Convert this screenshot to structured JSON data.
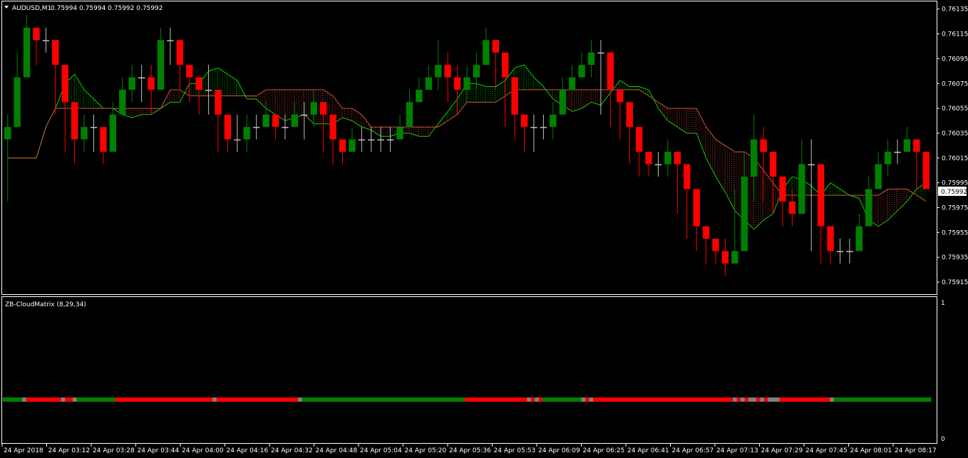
{
  "header": {
    "symbol": "AUDUSD,M1",
    "quotes": "0.75994 0.75994 0.75992 0.75992",
    "dropdown_icon": "triangle-down-icon"
  },
  "subwindow": {
    "title": "ZB-CloudMatrix (8,29,34)",
    "axis_top": "1",
    "axis_bottom": "0"
  },
  "colors": {
    "background": "#000000",
    "frame": "#ffffff",
    "bull": "#008000",
    "bear": "#ff0000",
    "neutral": "#c0c0c0",
    "matrix_gray": "#808080",
    "cloud_up": "#00ff00",
    "cloud_down": "#ff6347"
  },
  "chart_data": [
    {
      "type": "candlestick",
      "title": "AUDUSD,M1",
      "y_ticks": [
        "0.76135",
        "0.76115",
        "0.76095",
        "0.76075",
        "0.76055",
        "0.76035",
        "0.76015",
        "0.75995",
        "0.75975",
        "0.75955",
        "0.75935",
        "0.75915"
      ],
      "ylim": [
        0.75907,
        0.7614
      ],
      "current_price_label": "0.75992",
      "x_ticks": [
        "24 Apr 2018",
        "24 Apr 03:12",
        "24 Apr 03:28",
        "24 Apr 03:44",
        "24 Apr 04:00",
        "24 Apr 04:16",
        "24 Apr 04:32",
        "24 Apr 04:48",
        "24 Apr 05:04",
        "24 Apr 05:20",
        "24 Apr 05:36",
        "24 Apr 05:53",
        "24 Apr 06:09",
        "24 Apr 06:25",
        "24 Apr 06:41",
        "24 Apr 06:57",
        "24 Apr 07:13",
        "24 Apr 07:29",
        "24 Apr 07:45",
        "24 Apr 08:01",
        "24 Apr 08:17"
      ],
      "close": [
        0.7604,
        0.7608,
        0.7612,
        0.7611,
        0.7611,
        0.7609,
        0.7606,
        0.7603,
        0.7604,
        0.7604,
        0.7602,
        0.7605,
        0.7607,
        0.7608,
        0.7608,
        0.7607,
        0.7611,
        0.7611,
        0.7609,
        0.7608,
        0.7607,
        0.7607,
        0.7605,
        0.7603,
        0.7603,
        0.7604,
        0.7604,
        0.7605,
        0.7604,
        0.7604,
        0.7605,
        0.7605,
        0.7606,
        0.7605,
        0.7603,
        0.7602,
        0.7603,
        0.7603,
        0.7603,
        0.7603,
        0.7603,
        0.7604,
        0.7606,
        0.7607,
        0.7608,
        0.7609,
        0.7608,
        0.7607,
        0.7608,
        0.7609,
        0.7611,
        0.761,
        0.7608,
        0.7605,
        0.7604,
        0.7604,
        0.7604,
        0.7605,
        0.7607,
        0.7608,
        0.7609,
        0.761,
        0.761,
        0.7607,
        0.7606,
        0.7604,
        0.7602,
        0.7601,
        0.7601,
        0.7602,
        0.7601,
        0.7599,
        0.7596,
        0.7595,
        0.7594,
        0.7593,
        0.7594,
        0.76,
        0.7603,
        0.7602,
        0.76,
        0.7598,
        0.7597,
        0.7601,
        0.7601,
        0.7596,
        0.7594,
        0.7594,
        0.7594,
        0.7596,
        0.7599,
        0.7601,
        0.7602,
        0.7602,
        0.7603,
        0.7602,
        0.7599
      ],
      "high": [
        0.7605,
        0.761,
        0.7613,
        0.7612,
        0.7612,
        0.761,
        0.7607,
        0.7604,
        0.7605,
        0.7605,
        0.7604,
        0.7606,
        0.7608,
        0.7609,
        0.7609,
        0.7609,
        0.7612,
        0.7612,
        0.7611,
        0.7609,
        0.7608,
        0.7609,
        0.7606,
        0.7604,
        0.7605,
        0.7605,
        0.7605,
        0.7606,
        0.7605,
        0.7605,
        0.7606,
        0.7606,
        0.7607,
        0.7606,
        0.7604,
        0.7603,
        0.7604,
        0.7604,
        0.7604,
        0.7604,
        0.7604,
        0.7605,
        0.7607,
        0.7608,
        0.7609,
        0.7611,
        0.761,
        0.7609,
        0.7609,
        0.761,
        0.7612,
        0.7611,
        0.7609,
        0.7607,
        0.7605,
        0.7605,
        0.7605,
        0.7606,
        0.7608,
        0.7609,
        0.761,
        0.7611,
        0.7611,
        0.7609,
        0.7607,
        0.7605,
        0.7603,
        0.7602,
        0.7602,
        0.7603,
        0.7602,
        0.76,
        0.7597,
        0.7596,
        0.7595,
        0.7595,
        0.7599,
        0.7602,
        0.7605,
        0.7604,
        0.7601,
        0.7599,
        0.7599,
        0.7603,
        0.7603,
        0.7597,
        0.7595,
        0.7595,
        0.7595,
        0.7597,
        0.76,
        0.7602,
        0.7603,
        0.7603,
        0.7604,
        0.7603,
        0.76
      ],
      "low": [
        0.7598,
        0.7606,
        0.761,
        0.7609,
        0.761,
        0.7605,
        0.7602,
        0.7601,
        0.7602,
        0.7602,
        0.7601,
        0.7603,
        0.7605,
        0.7606,
        0.7606,
        0.7605,
        0.7609,
        0.7609,
        0.7607,
        0.7606,
        0.7605,
        0.7605,
        0.7602,
        0.7602,
        0.7602,
        0.7602,
        0.7603,
        0.7604,
        0.7603,
        0.7603,
        0.7604,
        0.7603,
        0.7604,
        0.7602,
        0.7601,
        0.7601,
        0.7602,
        0.7602,
        0.7602,
        0.7602,
        0.7602,
        0.7603,
        0.7605,
        0.7606,
        0.7607,
        0.7607,
        0.7606,
        0.7605,
        0.7606,
        0.7607,
        0.7609,
        0.7607,
        0.7604,
        0.7603,
        0.7602,
        0.7602,
        0.7603,
        0.7603,
        0.7605,
        0.7607,
        0.7608,
        0.7608,
        0.7605,
        0.7604,
        0.7603,
        0.7601,
        0.76,
        0.76,
        0.76,
        0.76,
        0.7597,
        0.7595,
        0.7594,
        0.7593,
        0.7593,
        0.7592,
        0.7594,
        0.7599,
        0.7598,
        0.7598,
        0.7597,
        0.7596,
        0.7596,
        0.7597,
        0.7594,
        0.7593,
        0.7593,
        0.7593,
        0.7593,
        0.7594,
        0.7597,
        0.7599,
        0.76,
        0.7601,
        0.7602,
        0.7599,
        0.7599
      ]
    },
    {
      "type": "heatmap",
      "title": "ZB-CloudMatrix (8,29,34)",
      "ylim": [
        0,
        1
      ],
      "states": [
        "green",
        "green",
        "green",
        "green",
        "green",
        "gray",
        "red",
        "red",
        "red",
        "red",
        "red",
        "red",
        "red",
        "red",
        "red",
        "gray",
        "red",
        "red",
        "gray",
        "green",
        "green",
        "green",
        "green",
        "green",
        "green",
        "green",
        "green",
        "green",
        "green",
        "red",
        "red",
        "red",
        "red",
        "red",
        "red",
        "red",
        "red",
        "red",
        "red",
        "red",
        "red",
        "red",
        "red",
        "red",
        "red",
        "red",
        "red",
        "red",
        "red",
        "red",
        "red",
        "red",
        "red",
        "red",
        "gray",
        "red",
        "red",
        "red",
        "red",
        "red",
        "red",
        "red",
        "red",
        "red",
        "red",
        "red",
        "red",
        "red",
        "red",
        "red",
        "red",
        "red",
        "red",
        "red",
        "red",
        "red",
        "gray",
        "green",
        "green",
        "green",
        "green",
        "green",
        "green",
        "green",
        "green",
        "green",
        "green",
        "green",
        "green",
        "green",
        "green",
        "green",
        "green",
        "green",
        "green",
        "green",
        "green",
        "green",
        "green",
        "green",
        "green",
        "green",
        "green",
        "green",
        "green",
        "green",
        "green",
        "green",
        "green",
        "green",
        "green",
        "green",
        "green",
        "green",
        "green",
        "green",
        "green",
        "green",
        "green",
        "red",
        "red",
        "red",
        "red",
        "red",
        "red",
        "red",
        "red",
        "red",
        "red",
        "red",
        "red",
        "red",
        "red",
        "red",
        "red",
        "gray",
        "red",
        "gray",
        "red",
        "green",
        "green",
        "green",
        "green",
        "green",
        "green",
        "green",
        "green",
        "green",
        "green",
        "gray",
        "red",
        "gray",
        "red",
        "red",
        "red",
        "red",
        "red",
        "red",
        "red",
        "red",
        "red",
        "red",
        "red",
        "red",
        "red",
        "red",
        "red",
        "red",
        "red",
        "red",
        "red",
        "red",
        "red",
        "red",
        "red",
        "red",
        "red",
        "red",
        "red",
        "red",
        "red",
        "red",
        "red",
        "red",
        "red",
        "red",
        "red",
        "red",
        "gray",
        "red",
        "gray",
        "red",
        "gray",
        "gray",
        "red",
        "gray",
        "red",
        "gray",
        "gray",
        "gray",
        "red",
        "red",
        "red",
        "red",
        "red",
        "red",
        "red",
        "red",
        "red",
        "red",
        "red",
        "red",
        "red",
        "gray",
        "green",
        "green",
        "green",
        "green",
        "green",
        "green",
        "green",
        "green",
        "green",
        "green",
        "green",
        "green",
        "green",
        "green",
        "green",
        "green",
        "green",
        "green",
        "green",
        "green",
        "green",
        "green",
        "green",
        "green",
        "green"
      ]
    }
  ]
}
